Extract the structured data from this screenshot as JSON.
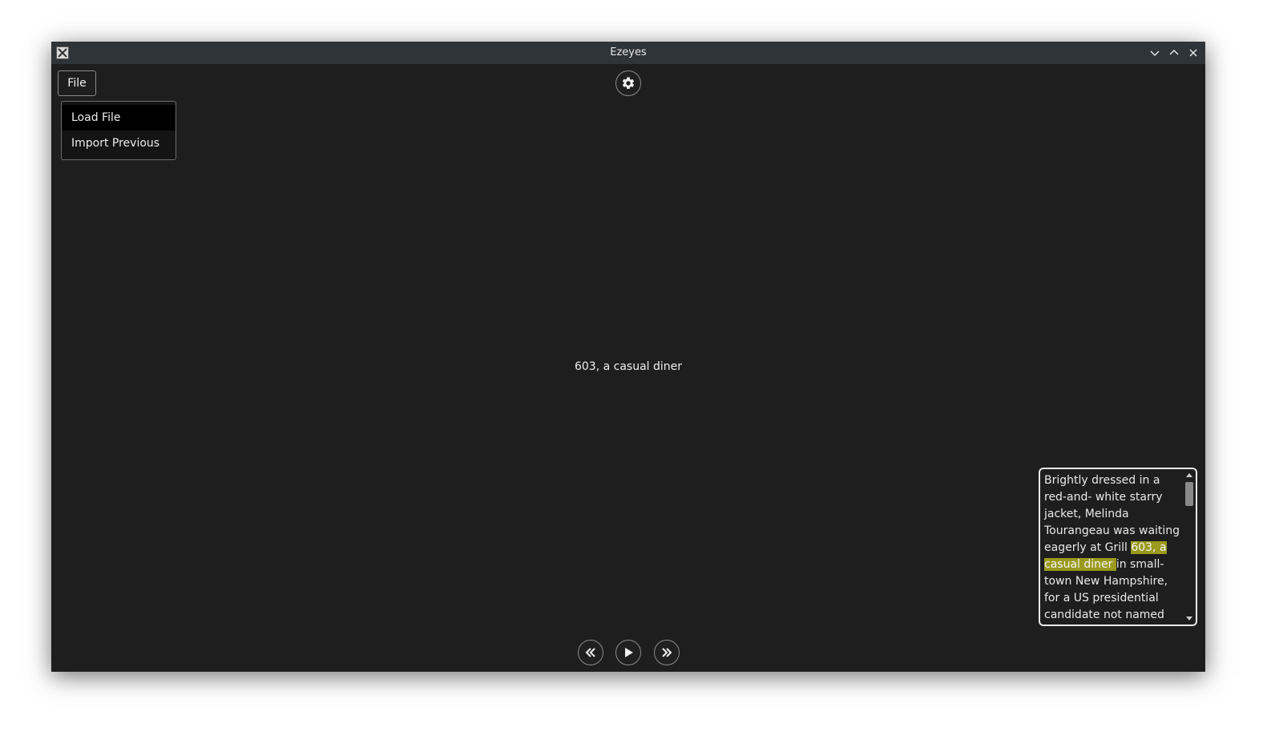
{
  "window": {
    "title": "Ezeyes"
  },
  "menu_bar": {
    "file_label": "File"
  },
  "file_menu": {
    "items": [
      {
        "label": "Load File"
      },
      {
        "label": "Import Previous"
      }
    ]
  },
  "reader": {
    "current_chunk": "603, a casual diner"
  },
  "text_panel": {
    "before": "Brightly dressed in a red-and- white starry jacket, Melinda Tourangeau was waiting eagerly at Grill ",
    "highlight": "603, a casual diner ",
    "after": "in small-town New Hampshire, for a US presidential candidate not named Donald Trump.",
    "highlight_color": "#9a9a1c"
  },
  "icons": {
    "app": "x11-app-icon",
    "minimize": "chevron-down-icon",
    "maximize": "chevron-up-icon",
    "close": "close-icon",
    "settings": "gear-icon",
    "rewind": "double-chevron-left-icon",
    "play": "play-icon",
    "forward": "double-chevron-right-icon"
  }
}
